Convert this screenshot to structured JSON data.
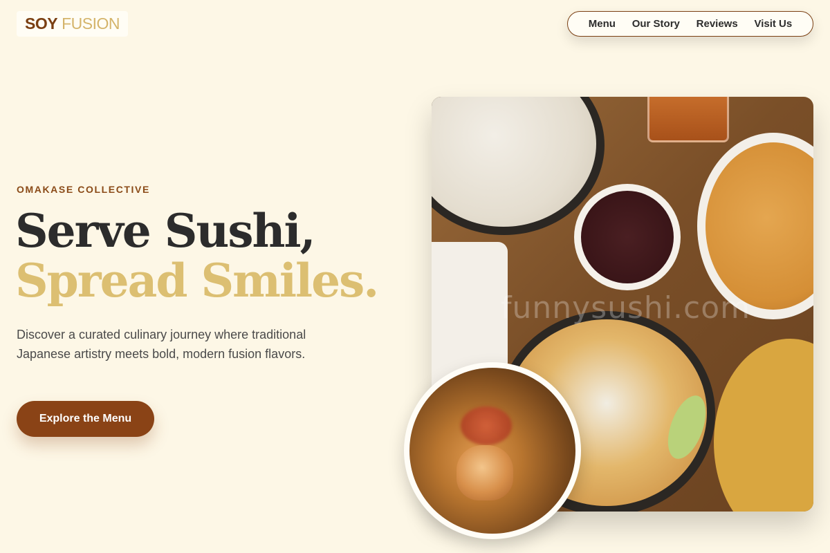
{
  "brand": {
    "word1": "SOY",
    "word2": "FUSION"
  },
  "nav": {
    "items": [
      {
        "label": "Menu"
      },
      {
        "label": "Our Story"
      },
      {
        "label": "Reviews"
      },
      {
        "label": "Visit Us"
      }
    ]
  },
  "hero": {
    "kicker": "OMAKASE COLLECTIVE",
    "headline_line1": "Serve Sushi,",
    "headline_line2": "Spread Smiles.",
    "description": "Discover a curated culinary journey where traditional Japanese artistry meets bold, modern fusion flavors.",
    "cta_label": "Explore the Menu",
    "image_watermark": "funnysushi.com"
  },
  "colors": {
    "background": "#fdf7e6",
    "accent_brown": "#8a4316",
    "accent_gold": "#dcbf72"
  }
}
